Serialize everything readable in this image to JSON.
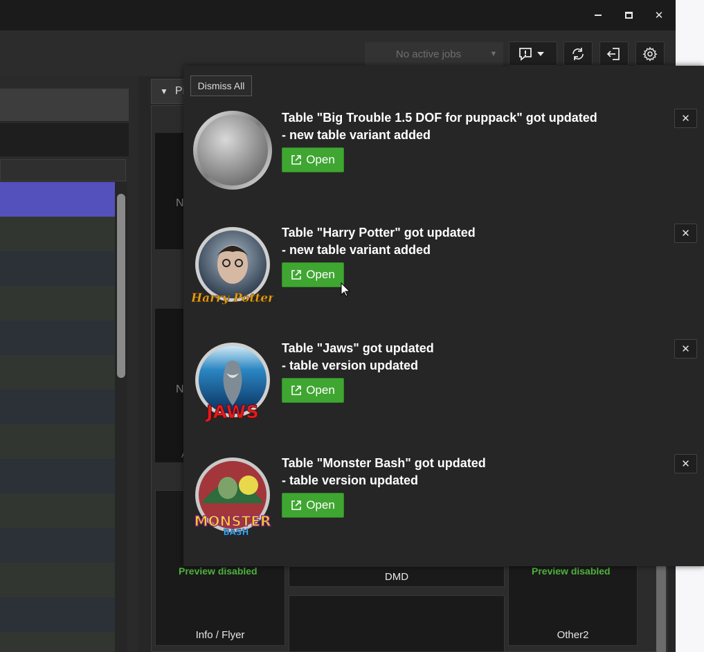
{
  "titlebar": {
    "minimize_glyph": "–",
    "maximize_glyph": "□",
    "close_glyph": "✕"
  },
  "toolbar": {
    "jobs_label": "No active jobs",
    "jobs_caret": "▼"
  },
  "right_pane": {
    "tab_label": "Pi",
    "partial_n1": "N",
    "partial_n2": "N",
    "partial_a": "A",
    "preview_disabled_left": "Preview disabled",
    "preview_disabled_right": "Preview disabled",
    "info_flyer_label": "Info / Flyer",
    "dmd_label": "DMD",
    "other2_label": "Other2"
  },
  "notifications": {
    "dismiss_all_label": "Dismiss All",
    "items": [
      {
        "line1": "Table \"Big Trouble 1.5 DOF for puppack\" got updated",
        "line2": "- new table variant added",
        "open_label": "Open",
        "avatar": "blank-disc-icon"
      },
      {
        "line1": "Table \"Harry Potter\" got updated",
        "line2": "- new table variant added",
        "open_label": "Open",
        "avatar": "harry-potter-logo",
        "logo_text": "Harry Potter"
      },
      {
        "line1": "Table \"Jaws\" got updated",
        "line2": "- table version updated",
        "open_label": "Open",
        "avatar": "jaws-logo",
        "logo_text": "JAWS"
      },
      {
        "line1": "Table \"Monster Bash\" got updated",
        "line2": "- table version updated",
        "open_label": "Open",
        "avatar": "monster-bash-logo",
        "logo_text": "MONSTER",
        "logo_text2": "BASH"
      }
    ]
  },
  "colors": {
    "open_button": "#3fa631",
    "selected_row": "#5451bd",
    "preview_disabled": "#4fb53e"
  }
}
